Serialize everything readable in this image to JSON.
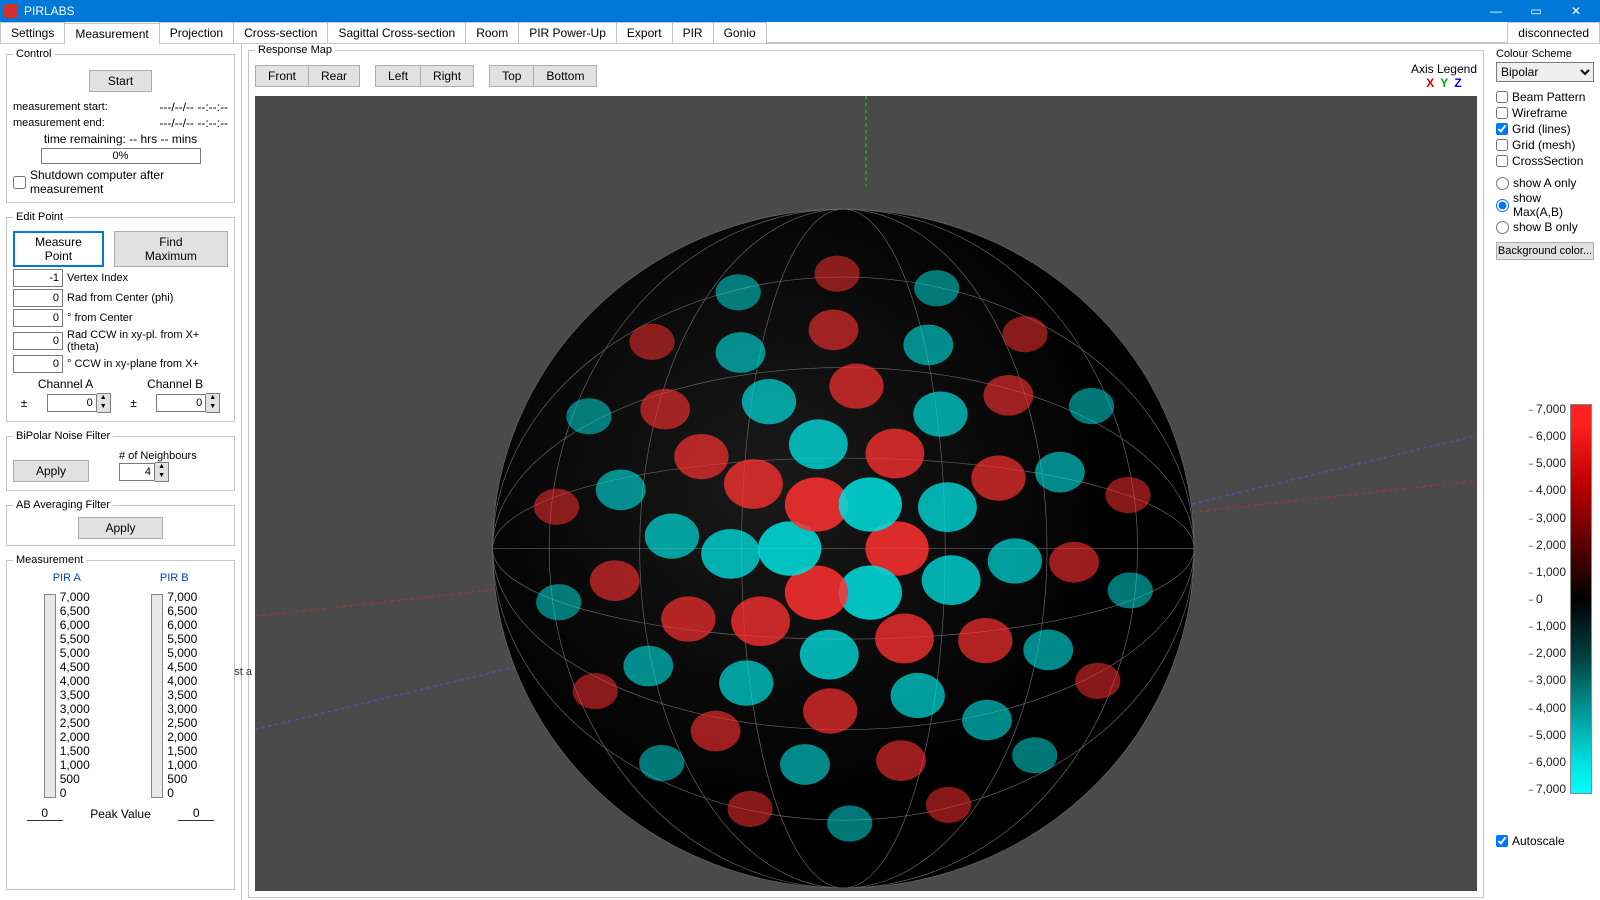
{
  "app": {
    "title": "PIRLABS",
    "status": "disconnected"
  },
  "window": {
    "min": "—",
    "max": "▭",
    "close": "✕"
  },
  "tabs": [
    "Settings",
    "Measurement",
    "Projection",
    "Cross-section",
    "Sagittal Cross-section",
    "Room",
    "PIR Power-Up",
    "Export",
    "PIR",
    "Gonio"
  ],
  "active_tab": 1,
  "control": {
    "legend": "Control",
    "start": "Start",
    "meas_start_lbl": "measurement start:",
    "meas_start_val": "---/--/-- --:--:--",
    "meas_end_lbl": "measurement end:",
    "meas_end_val": "---/--/-- --:--:--",
    "time_remain_lbl": "time remaining: -- hrs -- mins",
    "progress": "0%",
    "shutdown": "Shutdown computer after measurement"
  },
  "edit": {
    "legend": "Edit Point",
    "measure": "Measure Point",
    "findmax": "Find Maximum",
    "vertex_val": "-1",
    "vertex_lbl": "Vertex Index",
    "phi_val": "0",
    "phi_lbl": "Rad from Center (phi)",
    "deg_val": "0",
    "deg_lbl": "° from Center",
    "theta_val": "0",
    "theta_lbl": "Rad CCW in xy-pl. from X+ (theta)",
    "thetadeg_val": "0",
    "thetadeg_lbl": "° CCW in xy-plane from X+",
    "chA": "Channel A",
    "chB": "Channel B",
    "pm": "±",
    "chA_val": "0",
    "chB_val": "0"
  },
  "noise": {
    "legend": "BiPolar Noise Filter",
    "apply": "Apply",
    "neigh_lbl": "# of Neighbours",
    "neigh_val": "4"
  },
  "avg": {
    "legend": "AB Averaging Filter",
    "apply": "Apply"
  },
  "meas_panel": {
    "legend": "Measurement",
    "pirA": "PIR A",
    "pirB": "PIR B",
    "ticks": [
      "7,000",
      "6,500",
      "6,000",
      "5,500",
      "5,000",
      "4,500",
      "4,000",
      "3,500",
      "3,000",
      "2,500",
      "2,000",
      "1,500",
      "1,000",
      "500",
      "0"
    ],
    "peak_lbl": "Peak Value",
    "peakA": "0",
    "peakB": "0"
  },
  "resp": {
    "legend": "Response Map",
    "front": "Front",
    "rear": "Rear",
    "left": "Left",
    "right": "Right",
    "top": "Top",
    "bottom": "Bottom",
    "axis_legend": "Axis Legend",
    "X": "X",
    "Y": "Y",
    "Z": "Z"
  },
  "right": {
    "scheme_lbl": "Colour Scheme",
    "scheme_val": "Bipolar",
    "beam": "Beam Pattern",
    "wire": "Wireframe",
    "gridl": "Grid (lines)",
    "gridm": "Grid (mesh)",
    "cross": "CrossSection",
    "showA": "show A only",
    "showMax": "show Max(A,B)",
    "showB": "show B only",
    "bgcolor": "Background color...",
    "autoscale": "Autoscale"
  },
  "colorbar": [
    "7,000",
    "6,000",
    "5,000",
    "4,000",
    "3,000",
    "2,000",
    "1,000",
    "0",
    "1,000",
    "2,000",
    "3,000",
    "4,000",
    "5,000",
    "6,000",
    "7,000"
  ],
  "truncated": "st a",
  "chart_data": {
    "type": "heatmap",
    "title": "Response Map (spherical polar)",
    "color_scale": "Bipolar",
    "range": [
      -7000,
      7000
    ],
    "ticks": [
      -7000,
      -6000,
      -5000,
      -4000,
      -3000,
      -2000,
      -1000,
      0,
      1000,
      2000,
      3000,
      4000,
      5000,
      6000,
      7000
    ],
    "axes": [
      "X",
      "Y",
      "Z"
    ],
    "note": "3D sphere with alternating positive(red)/negative(cyan) lobes on grey background; grid(lines) overlay on"
  }
}
